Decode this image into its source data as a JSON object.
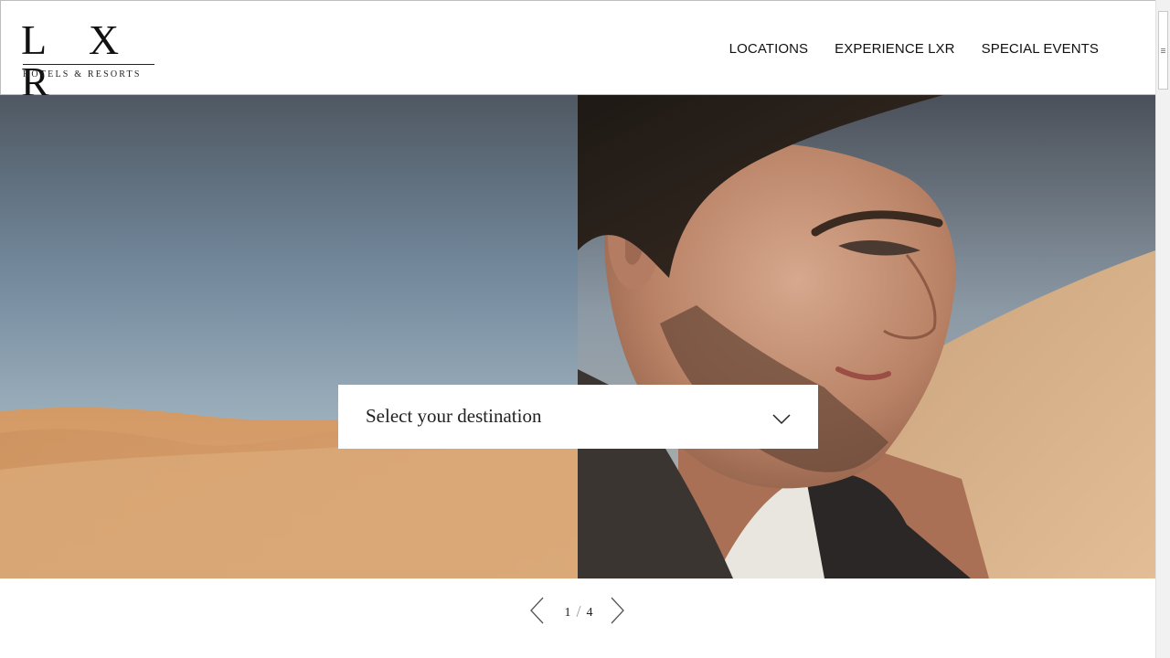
{
  "brand": {
    "logo_text": "L X R",
    "logo_subtitle": "HOTELS & RESORTS"
  },
  "nav": {
    "items": [
      {
        "label": "LOCATIONS"
      },
      {
        "label": "EXPERIENCE LXR"
      },
      {
        "label": "SPECIAL EVENTS"
      }
    ]
  },
  "destination": {
    "placeholder": "Select your destination",
    "icon": "chevron-down-icon"
  },
  "slider": {
    "current": "1",
    "separator": "/",
    "total": "4",
    "prev_icon": "chevron-left-icon",
    "next_icon": "chevron-right-icon"
  },
  "hero": {
    "left_image": "desert-walker",
    "right_image": "man-portrait-profile"
  },
  "colors": {
    "text": "#111111",
    "sand": "#d9a06e",
    "sky": "#8aa0b0"
  }
}
